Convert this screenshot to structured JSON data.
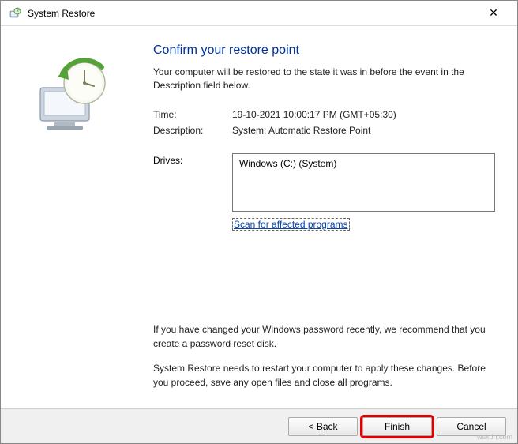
{
  "window": {
    "title": "System Restore",
    "close_glyph": "✕"
  },
  "heading": "Confirm your restore point",
  "subtext": "Your computer will be restored to the state it was in before the event in the Description field below.",
  "info": {
    "time_label": "Time:",
    "time_value": "19-10-2021 10:00:17 PM (GMT+05:30)",
    "desc_label": "Description:",
    "desc_value": "System: Automatic Restore Point"
  },
  "drives": {
    "label": "Drives:",
    "list": "Windows (C:) (System)",
    "scan_link": "Scan for affected programs"
  },
  "note1": "If you have changed your Windows password recently, we recommend that you create a password reset disk.",
  "note2": "System Restore needs to restart your computer to apply these changes. Before you proceed, save any open files and close all programs.",
  "buttons": {
    "back_prefix": "< ",
    "back_key": "B",
    "back_rest": "ack",
    "finish": "Finish",
    "cancel": "Cancel"
  },
  "watermark": "wsxdn.com"
}
